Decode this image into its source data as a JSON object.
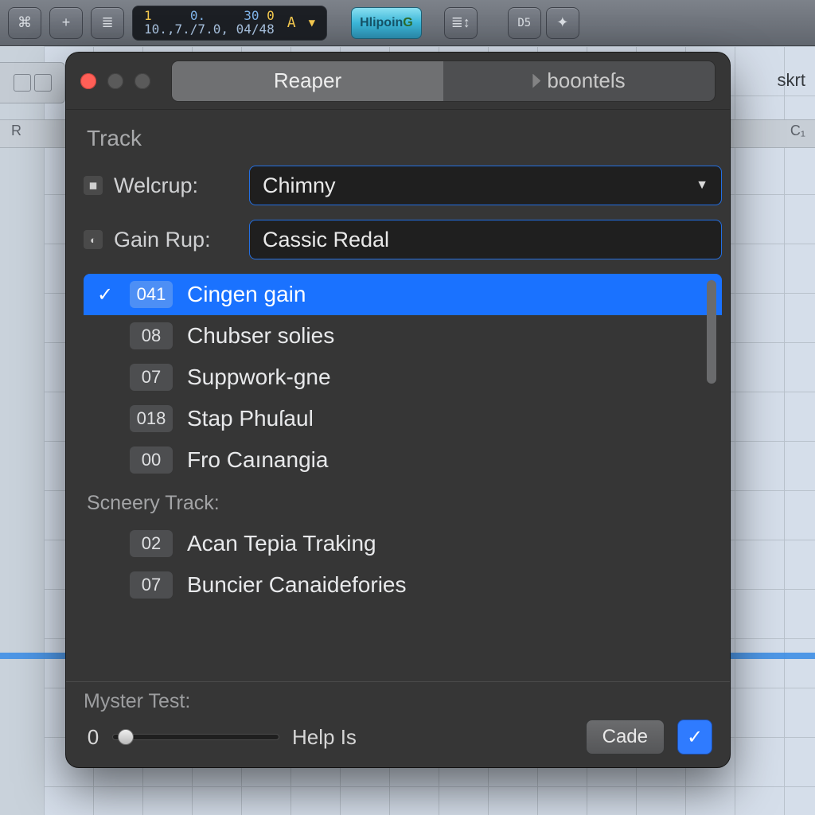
{
  "toolbar": {
    "lcd_top": {
      "a": "1",
      "b": "0.",
      "c": "30",
      "d": "0"
    },
    "lcd_bot": "10.,7./7.0, 04/48",
    "lcd_letter": "A",
    "hipoing_prefix": "Hlipoin",
    "hipoing_suffix": "G"
  },
  "background": {
    "ruler_left": "R",
    "ruler_right": "C₁",
    "skrt": "skrt"
  },
  "modal": {
    "tabs": {
      "active": "Reaper",
      "other": "boonteſs"
    },
    "section1": "Track",
    "row1": {
      "label": "Welcrup:",
      "value": "Chimny"
    },
    "row2": {
      "label": "Gain Rup:",
      "value": "Cassic Redal"
    },
    "list1": [
      {
        "checked": true,
        "num": "041",
        "label": "Cingen gain"
      },
      {
        "checked": false,
        "num": "08",
        "label": "Chubser solies"
      },
      {
        "checked": false,
        "num": "07",
        "label": "Suppwork-gne"
      },
      {
        "checked": false,
        "num": "018",
        "label": "Stap Phuſaul"
      },
      {
        "checked": false,
        "num": "00",
        "label": "Fro Caınangia"
      }
    ],
    "section2": "Scneery Track:",
    "list2": [
      {
        "num": "02",
        "label": "Acan Tepia Traking"
      },
      {
        "num": "07",
        "label": "Buncier Canaidefories"
      }
    ],
    "footer": {
      "label": "Myster Test:",
      "slider_value": "0",
      "help": "Help Is",
      "cade": "Cade"
    }
  }
}
